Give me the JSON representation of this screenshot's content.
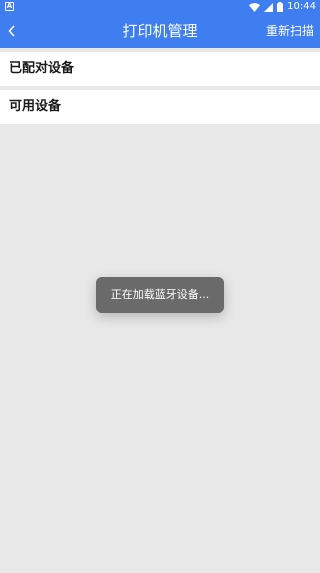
{
  "status_bar": {
    "app_icon_letter": "A",
    "time": "10:44"
  },
  "app_bar": {
    "title": "打印机管理",
    "action_label": "重新扫描"
  },
  "sections": {
    "paired_title": "已配对设备",
    "available_title": "可用设备"
  },
  "toast": {
    "message": "正在加载蓝牙设备..."
  },
  "colors": {
    "primary": "#3f7ef0",
    "background": "#e8e8e8",
    "toast_background": "#6a6a6a"
  },
  "icons": {
    "back": "chevron-left-icon",
    "wifi": "wifi-icon",
    "signal": "cellular-signal-icon",
    "battery": "battery-icon"
  }
}
